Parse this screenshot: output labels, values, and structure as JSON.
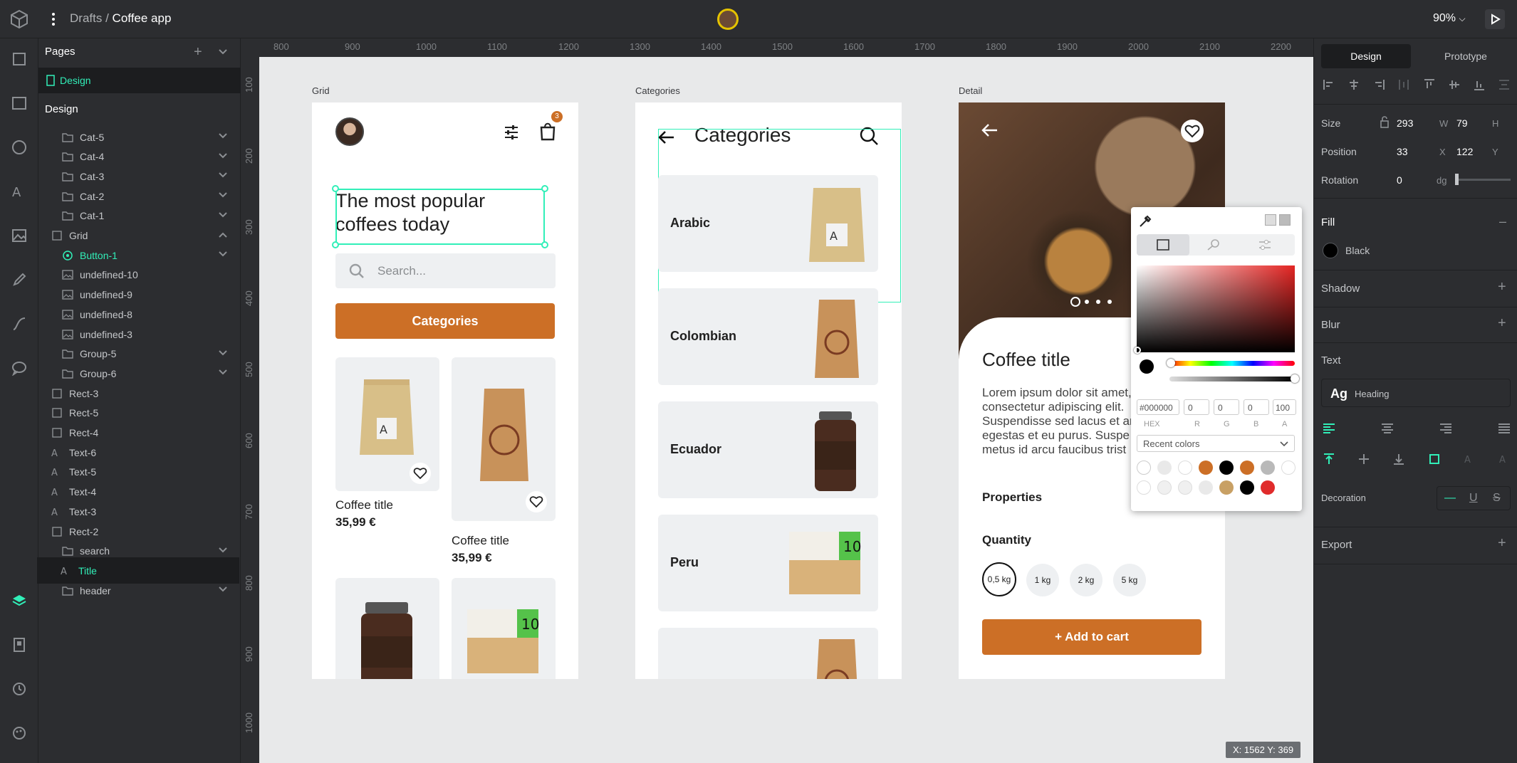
{
  "topbar": {
    "breadcrumb_parent": "Drafts",
    "breadcrumb_sep": "/",
    "breadcrumb_current": "Coffee app",
    "zoom": "90%"
  },
  "pages": {
    "title": "Pages",
    "items": [
      {
        "label": "Design"
      }
    ]
  },
  "layers": {
    "section": "Design",
    "items": [
      {
        "label": "Cat-5",
        "type": "board",
        "chev": "down"
      },
      {
        "label": "Cat-4",
        "type": "board",
        "chev": "down"
      },
      {
        "label": "Cat-3",
        "type": "board",
        "chev": "down"
      },
      {
        "label": "Cat-2",
        "type": "board",
        "chev": "down"
      },
      {
        "label": "Cat-1",
        "type": "board",
        "chev": "down"
      },
      {
        "label": "Grid",
        "type": "rect",
        "chev": "up"
      },
      {
        "label": "Button-1",
        "type": "component",
        "chev": "down"
      },
      {
        "label": "undefined-10",
        "type": "image"
      },
      {
        "label": "undefined-9",
        "type": "image"
      },
      {
        "label": "undefined-8",
        "type": "image"
      },
      {
        "label": "undefined-3",
        "type": "image"
      },
      {
        "label": "Group-5",
        "type": "board",
        "chev": "down"
      },
      {
        "label": "Group-6",
        "type": "board",
        "chev": "down"
      },
      {
        "label": "Rect-3",
        "type": "rect"
      },
      {
        "label": "Rect-5",
        "type": "rect"
      },
      {
        "label": "Rect-4",
        "type": "rect"
      },
      {
        "label": "Text-6",
        "type": "text"
      },
      {
        "label": "Text-5",
        "type": "text"
      },
      {
        "label": "Text-4",
        "type": "text"
      },
      {
        "label": "Text-3",
        "type": "text"
      },
      {
        "label": "Rect-2",
        "type": "rect"
      },
      {
        "label": "search",
        "type": "board",
        "chev": "down"
      },
      {
        "label": "Title",
        "type": "text"
      },
      {
        "label": "header",
        "type": "board",
        "chev": "down"
      }
    ]
  },
  "ruler": {
    "top": [
      "800",
      "900",
      "1000",
      "1100",
      "1200",
      "1300",
      "1400",
      "1500",
      "1600",
      "1700",
      "1800",
      "1900",
      "2000",
      "2100",
      "2200"
    ],
    "left": [
      "100",
      "200",
      "300",
      "400",
      "500",
      "600",
      "700",
      "800",
      "900",
      "1000"
    ]
  },
  "boards": {
    "grid": {
      "label": "Grid",
      "title": "The most popular coffees today",
      "search_placeholder": "Search...",
      "cart_count": "3",
      "categories_button": "Categories",
      "products": [
        {
          "title": "Coffee title",
          "price": "35,99 €"
        },
        {
          "title": "Coffee title",
          "price": "35,99 €"
        }
      ]
    },
    "categories": {
      "label": "Categories",
      "title": "Categories",
      "items": [
        "Arabic",
        "Colombian",
        "Ecuador",
        "Peru"
      ]
    },
    "detail": {
      "label": "Detail",
      "title": "Coffee title",
      "lorem": [
        "Lorem ipsum dolor sit amet,",
        "consectetur adipiscing elit.",
        "Suspendisse sed lacus et ar",
        "egestas et eu purus. Suspe",
        "metus id arcu faucibus trist"
      ],
      "properties": "Properties",
      "quantity": "Quantity",
      "sizes": [
        "0,5 kg",
        "1 kg",
        "2 kg",
        "5 kg"
      ],
      "add_to_cart": "+ Add to cart"
    }
  },
  "coords": "X: 1562 Y: 369",
  "right": {
    "tabs": [
      "Design",
      "Prototype"
    ],
    "size": {
      "label": "Size",
      "w": "293",
      "w_unit": "W",
      "h": "79",
      "h_unit": "H"
    },
    "position": {
      "label": "Position",
      "x": "33",
      "x_unit": "X",
      "y": "122",
      "y_unit": "Y"
    },
    "rotation": {
      "label": "Rotation",
      "value": "0",
      "unit": "dg"
    },
    "fill": {
      "label": "Fill",
      "color_name": "Black",
      "color": "#000000"
    },
    "shadow": "Shadow",
    "blur": "Blur",
    "text": "Text",
    "typo_ag": "Ag",
    "typo_name": "Heading",
    "decoration": "Decoration",
    "export": "Export"
  },
  "picker": {
    "hex": "#000000",
    "r": "0",
    "g": "0",
    "b": "0",
    "a": "100",
    "labels": [
      "HEX",
      "R",
      "G",
      "B",
      "A"
    ],
    "recent": "Recent colors",
    "swatches_row1": [
      "#e9e9e9",
      "#ffffff",
      "#cc6f26",
      "#000000",
      "#cc6f26",
      "#b9b9b9",
      "#ffffff"
    ],
    "swatches_row2": [
      "#ffffff",
      "#f0f0f0",
      "#f0f0f0",
      "#e9e9e9",
      "#c8a064",
      "#000000",
      "#e02b2b"
    ]
  },
  "colors": {
    "accent": "#31efb8",
    "brand": "#cc6f26",
    "panel": "#2c2d30"
  }
}
